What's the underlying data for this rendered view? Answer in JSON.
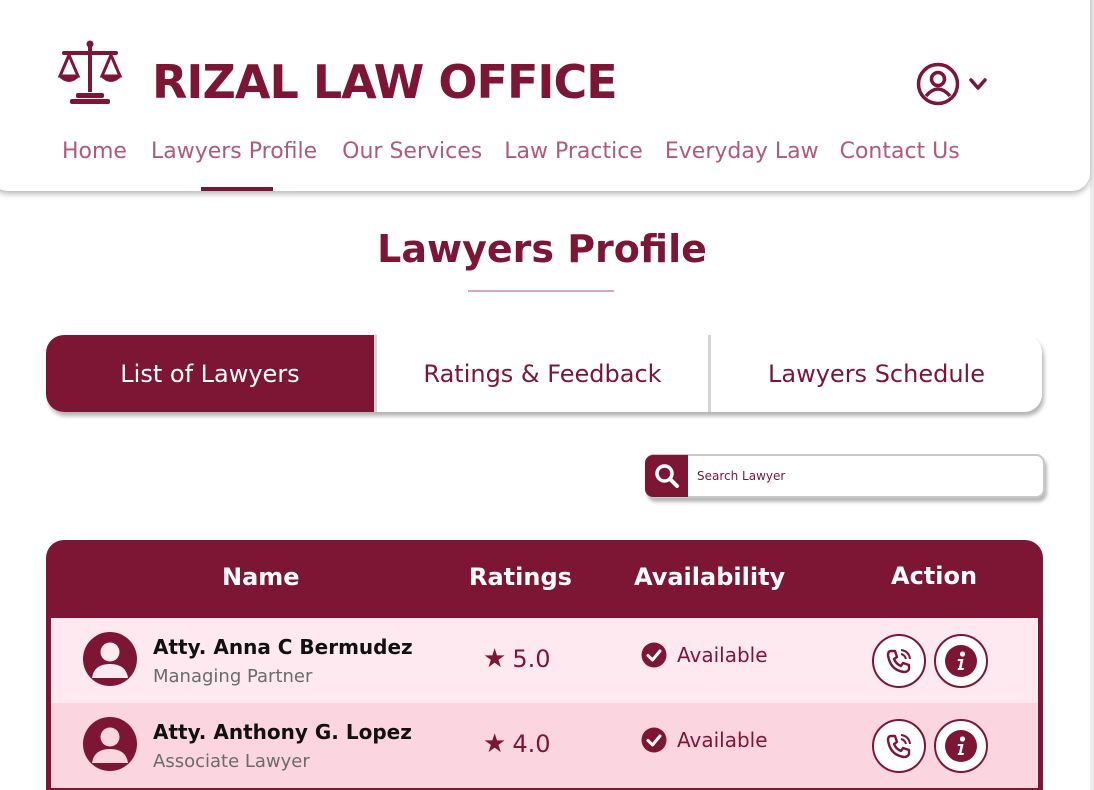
{
  "brand": {
    "name": "RIZAL LAW OFFICE",
    "logo": "scales-of-justice-icon"
  },
  "user_menu": {
    "icon": "user-circle-icon",
    "chevron": "chevron-down-icon"
  },
  "nav": [
    {
      "label": "Home",
      "active": false
    },
    {
      "label": "Lawyers Profile",
      "active": true
    },
    {
      "label": "Our Services",
      "active": false
    },
    {
      "label": "Law Practice",
      "active": false
    },
    {
      "label": "Everyday Law",
      "active": false
    },
    {
      "label": "Contact Us",
      "active": false
    }
  ],
  "page_title": "Lawyers Profile",
  "tabs": [
    {
      "label": "List of Lawyers",
      "active": true
    },
    {
      "label": "Ratings & Feedback",
      "active": false
    },
    {
      "label": "Lawyers Schedule",
      "active": false
    }
  ],
  "search": {
    "placeholder": "Search Lawyer",
    "value": "",
    "icon": "search-icon"
  },
  "table": {
    "columns": [
      "Name",
      "Ratings",
      "Availability",
      "Action"
    ],
    "rows": [
      {
        "name": "Atty. Anna C Bermudez",
        "role": "Managing Partner",
        "rating": "5.0",
        "availability": "Available"
      },
      {
        "name": "Atty. Anthony G. Lopez",
        "role": "Associate Lawyer",
        "rating": "4.0",
        "availability": "Available"
      }
    ]
  },
  "colors": {
    "primary": "#7d1535",
    "row_light": "#fde9ef",
    "row_pink": "#fbd5e0",
    "nav_text": "#b05a78"
  }
}
